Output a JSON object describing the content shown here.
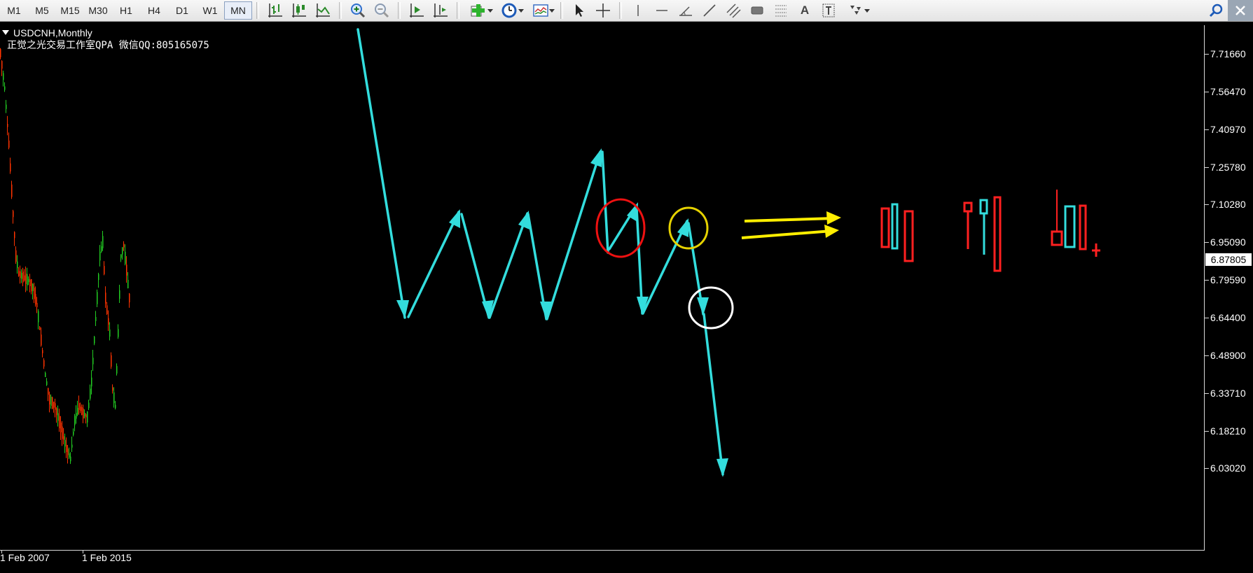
{
  "toolbar": {
    "timeframes": [
      "M1",
      "M5",
      "M15",
      "M30",
      "H1",
      "H4",
      "D1",
      "W1",
      "MN"
    ],
    "active_timeframe": "MN",
    "text_tool_label": "A"
  },
  "chart": {
    "symbol_label": "USDCNH,Monthly",
    "watermark": "正觉之光交易工作室QPA 微信QQ:805165075",
    "price_labels": [
      "7.71660",
      "7.56470",
      "7.40970",
      "7.25780",
      "7.10280",
      "6.95090",
      "6.79590",
      "6.64400",
      "6.48900",
      "6.33710",
      "6.18210",
      "6.03020"
    ],
    "current_price": "6.87805",
    "time_labels": [
      "1 Feb 2007",
      "1 Feb 2015"
    ],
    "colors": {
      "background": "#000000",
      "bull_candle": "#22cc22",
      "bear_candle": "#ff3300",
      "zigzag": "#33dddd",
      "arrows": "#ffee00",
      "red_circle": "#ee1111",
      "yellow_circle": "#e6d200",
      "white_circle": "#ffffff",
      "pattern_red": "#ff2020",
      "pattern_cyan": "#33dddd"
    }
  }
}
